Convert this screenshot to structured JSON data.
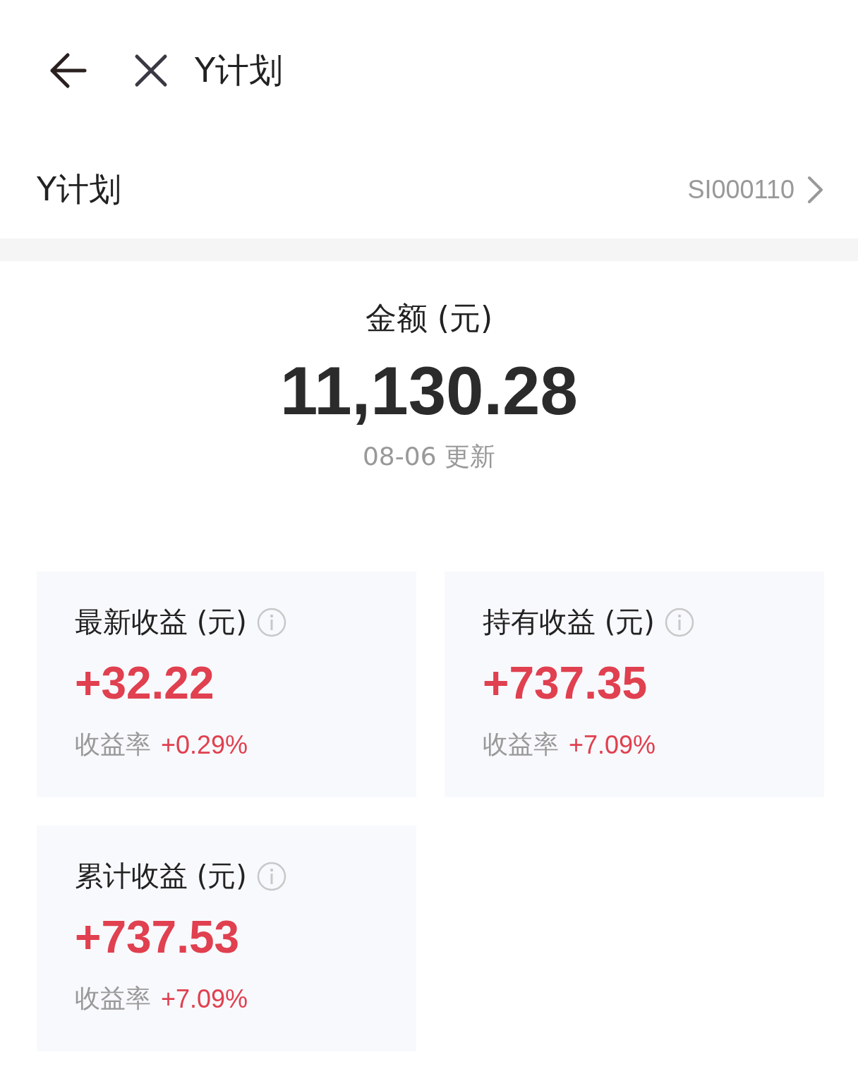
{
  "header": {
    "title": "Y计划"
  },
  "plan": {
    "name": "Y计划",
    "code": "SI000110"
  },
  "summary": {
    "label": "金额 (元)",
    "amount": "11,130.28",
    "updated": "08-06 更新"
  },
  "cards": [
    {
      "title": "最新收益 (元)",
      "value": "+32.22",
      "rate_label": "收益率",
      "rate": "+0.29%"
    },
    {
      "title": "持有收益 (元)",
      "value": "+737.35",
      "rate_label": "收益率",
      "rate": "+7.09%"
    },
    {
      "title": "累计收益 (元)",
      "value": "+737.53",
      "rate_label": "收益率",
      "rate": "+7.09%"
    }
  ]
}
